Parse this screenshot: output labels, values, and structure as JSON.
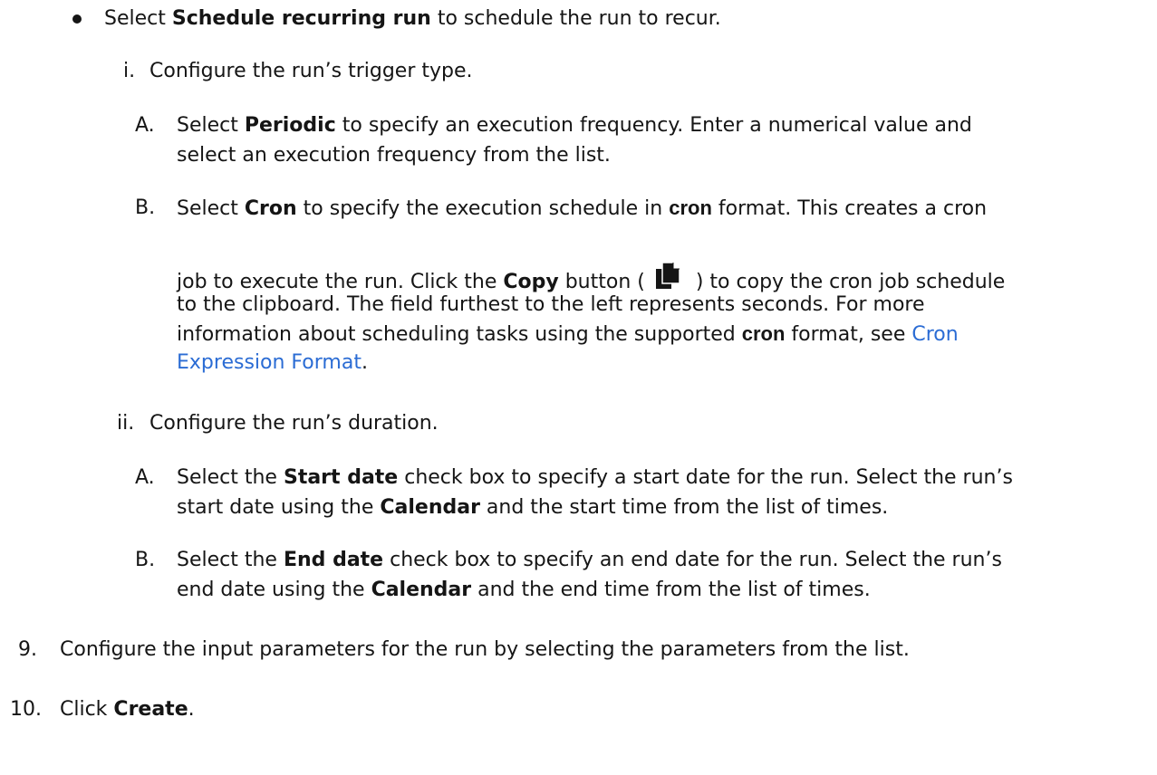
{
  "bullet_item": {
    "t1": "Select ",
    "b1": "Schedule recurring run",
    "t2": " to schedule the run to recur."
  },
  "trigger": {
    "marker": "i.",
    "text": "Configure the run’s trigger type.",
    "periodic": {
      "marker": "A.",
      "t1": "Select ",
      "b1": "Periodic",
      "t2": " to specify an execution frequency. Enter a numerical value and",
      "t3": "select an execution frequency from the list."
    },
    "cron": {
      "marker": "B.",
      "t1": "Select ",
      "b1": "Cron",
      "t2": " to specify the execution schedule in ",
      "code1": "cron",
      "t3": " format. This creates a cron",
      "t4": "job to execute the run. Click the ",
      "b2": "Copy",
      "t5": " button (",
      "icon": "copy-icon",
      "t6": ") to copy the cron job schedule",
      "t7": "to the clipboard. The field furthest to the left represents seconds. For more",
      "t8": "information about scheduling tasks using the supported ",
      "code2": "cron",
      "t9": " format, see ",
      "link_a": "Cron",
      "link_b": "Expression Format",
      "t10": "."
    }
  },
  "duration": {
    "marker": "ii.",
    "text": "Configure the run’s duration.",
    "start": {
      "marker": "A.",
      "t1": "Select the ",
      "b1": "Start date",
      "t2": " check box to specify a start date for the run. Select the run’s",
      "t3": "start date using the ",
      "b2": "Calendar",
      "t4": " and the start time from the list of times."
    },
    "end": {
      "marker": "B.",
      "t1": "Select the ",
      "b1": "End date",
      "t2": " check box to specify an end date for the run. Select the run’s",
      "t3": "end date using the ",
      "b2": "Calendar",
      "t4": " and the end time from the list of times."
    }
  },
  "step9": {
    "marker": "9.",
    "text": "Configure the input parameters for the run by selecting the parameters from the list."
  },
  "step10": {
    "marker": "10.",
    "t1": "Click ",
    "b1": "Create",
    "t2": "."
  },
  "colors": {
    "text": "#151515",
    "link": "#2b6cd4"
  }
}
